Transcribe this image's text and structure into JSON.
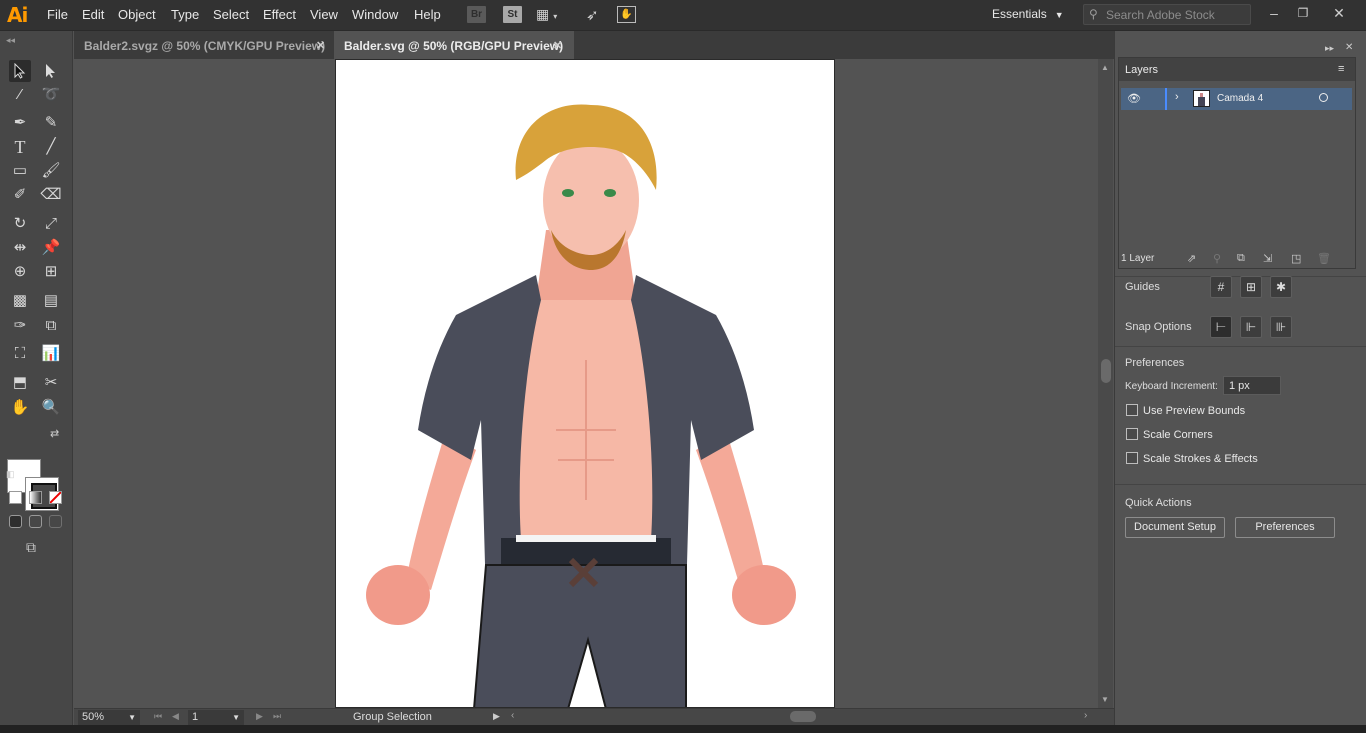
{
  "app": {
    "logo": "Ai",
    "menus": [
      {
        "label": "File"
      },
      {
        "label": "Edit"
      },
      {
        "label": "Object"
      },
      {
        "label": "Type"
      },
      {
        "label": "Select"
      },
      {
        "label": "Effect"
      },
      {
        "label": "View"
      },
      {
        "label": "Window"
      },
      {
        "label": "Help"
      }
    ],
    "bridge_label": "Br",
    "stock_label": "St",
    "workspace": "Essentials",
    "search_placeholder": "Search Adobe Stock"
  },
  "tabs": [
    {
      "label": "Balder2.svgz @ 50% (CMYK/GPU Preview)",
      "active": false
    },
    {
      "label": "Balder.svg @ 50% (RGB/GPU Preview)",
      "active": true
    }
  ],
  "status": {
    "zoom": "50%",
    "page": "1",
    "current_tool": "Group Selection"
  },
  "layers_panel": {
    "title": "Layers",
    "layer_name": "Camada 4",
    "layer_count": "1 Layer"
  },
  "properties": {
    "guides_label": "Guides",
    "snap_label": "Snap Options",
    "preferences_heading": "Preferences",
    "keyboard_increment_label": "Keyboard Increment:",
    "keyboard_increment_value": "1 px",
    "checkboxes": [
      {
        "label": "Use Preview Bounds",
        "checked": false
      },
      {
        "label": "Scale Corners",
        "checked": false
      },
      {
        "label": "Scale Strokes & Effects",
        "checked": false
      }
    ],
    "quick_actions_heading": "Quick Actions",
    "document_setup_button": "Document Setup",
    "preferences_button": "Preferences"
  },
  "colors": {
    "accent_logo": "#ff9a00",
    "layer_highlight": "#4b6584",
    "fill": "#ffffff",
    "stroke": "#000000",
    "shirt": "#4a4d5a",
    "skin": "#f6b8a6",
    "hair": "#d8a23a"
  }
}
